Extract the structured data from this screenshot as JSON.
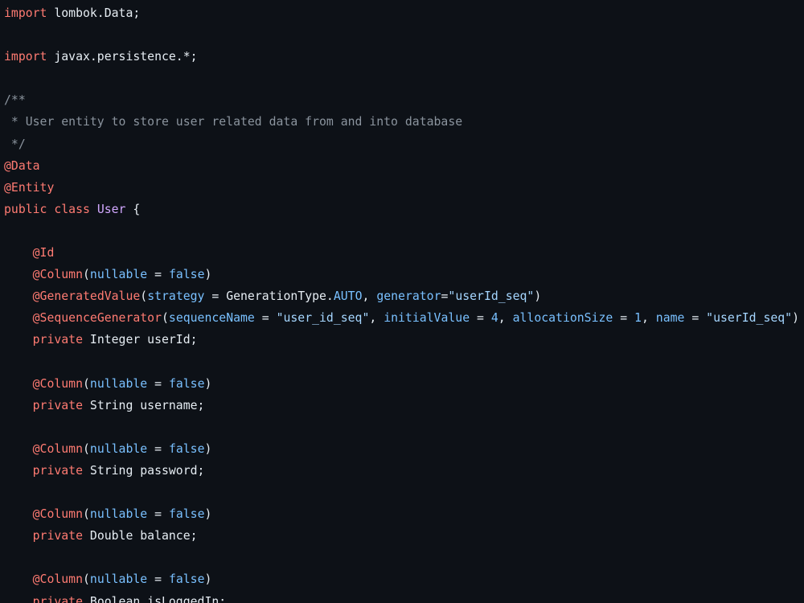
{
  "editor": {
    "theme": {
      "background": "#0d1117",
      "text": "#e6edf3",
      "keyword": "#ff7b72",
      "comment": "#8b949e",
      "attribute": "#79c0ff",
      "string": "#a5d6ff",
      "class_name": "#d2a8ff"
    },
    "lines": [
      [
        {
          "t": "keyword",
          "v": "import"
        },
        {
          "t": "plain",
          "v": " lombok.Data;"
        }
      ],
      [],
      [
        {
          "t": "keyword",
          "v": "import"
        },
        {
          "t": "plain",
          "v": " javax.persistence.*;"
        }
      ],
      [],
      [
        {
          "t": "comment",
          "v": "/**"
        }
      ],
      [
        {
          "t": "comment",
          "v": " * User entity to store user related data from and into database"
        }
      ],
      [
        {
          "t": "comment",
          "v": " */"
        }
      ],
      [
        {
          "t": "annotation",
          "v": "@Data"
        }
      ],
      [
        {
          "t": "annotation",
          "v": "@Entity"
        }
      ],
      [
        {
          "t": "keyword",
          "v": "public class"
        },
        {
          "t": "plain",
          "v": " "
        },
        {
          "t": "classname",
          "v": "User"
        },
        {
          "t": "plain",
          "v": " {"
        }
      ],
      [],
      [
        {
          "t": "plain",
          "v": "    "
        },
        {
          "t": "annotation",
          "v": "@Id"
        }
      ],
      [
        {
          "t": "plain",
          "v": "    "
        },
        {
          "t": "annotation",
          "v": "@Column"
        },
        {
          "t": "plain",
          "v": "("
        },
        {
          "t": "attr",
          "v": "nullable"
        },
        {
          "t": "plain",
          "v": " = "
        },
        {
          "t": "const",
          "v": "false"
        },
        {
          "t": "plain",
          "v": ")"
        }
      ],
      [
        {
          "t": "plain",
          "v": "    "
        },
        {
          "t": "annotation",
          "v": "@GeneratedValue"
        },
        {
          "t": "plain",
          "v": "("
        },
        {
          "t": "attr",
          "v": "strategy"
        },
        {
          "t": "plain",
          "v": " = GenerationType."
        },
        {
          "t": "const",
          "v": "AUTO"
        },
        {
          "t": "plain",
          "v": ", "
        },
        {
          "t": "attr",
          "v": "generator"
        },
        {
          "t": "plain",
          "v": "="
        },
        {
          "t": "string",
          "v": "\"userId_seq\""
        },
        {
          "t": "plain",
          "v": ")"
        }
      ],
      [
        {
          "t": "plain",
          "v": "    "
        },
        {
          "t": "annotation",
          "v": "@SequenceGenerator"
        },
        {
          "t": "plain",
          "v": "("
        },
        {
          "t": "attr",
          "v": "sequenceName"
        },
        {
          "t": "plain",
          "v": " = "
        },
        {
          "t": "string",
          "v": "\"user_id_seq\""
        },
        {
          "t": "plain",
          "v": ", "
        },
        {
          "t": "attr",
          "v": "initialValue"
        },
        {
          "t": "plain",
          "v": " = "
        },
        {
          "t": "const",
          "v": "4"
        },
        {
          "t": "plain",
          "v": ", "
        },
        {
          "t": "attr",
          "v": "allocationSize"
        },
        {
          "t": "plain",
          "v": " = "
        },
        {
          "t": "const",
          "v": "1"
        },
        {
          "t": "plain",
          "v": ", "
        },
        {
          "t": "attr",
          "v": "name"
        },
        {
          "t": "plain",
          "v": " = "
        },
        {
          "t": "string",
          "v": "\"userId_seq\""
        },
        {
          "t": "plain",
          "v": ")"
        }
      ],
      [
        {
          "t": "plain",
          "v": "    "
        },
        {
          "t": "keyword",
          "v": "private"
        },
        {
          "t": "plain",
          "v": " Integer userId;"
        }
      ],
      [],
      [
        {
          "t": "plain",
          "v": "    "
        },
        {
          "t": "annotation",
          "v": "@Column"
        },
        {
          "t": "plain",
          "v": "("
        },
        {
          "t": "attr",
          "v": "nullable"
        },
        {
          "t": "plain",
          "v": " = "
        },
        {
          "t": "const",
          "v": "false"
        },
        {
          "t": "plain",
          "v": ")"
        }
      ],
      [
        {
          "t": "plain",
          "v": "    "
        },
        {
          "t": "keyword",
          "v": "private"
        },
        {
          "t": "plain",
          "v": " String username;"
        }
      ],
      [],
      [
        {
          "t": "plain",
          "v": "    "
        },
        {
          "t": "annotation",
          "v": "@Column"
        },
        {
          "t": "plain",
          "v": "("
        },
        {
          "t": "attr",
          "v": "nullable"
        },
        {
          "t": "plain",
          "v": " = "
        },
        {
          "t": "const",
          "v": "false"
        },
        {
          "t": "plain",
          "v": ")"
        }
      ],
      [
        {
          "t": "plain",
          "v": "    "
        },
        {
          "t": "keyword",
          "v": "private"
        },
        {
          "t": "plain",
          "v": " String password;"
        }
      ],
      [],
      [
        {
          "t": "plain",
          "v": "    "
        },
        {
          "t": "annotation",
          "v": "@Column"
        },
        {
          "t": "plain",
          "v": "("
        },
        {
          "t": "attr",
          "v": "nullable"
        },
        {
          "t": "plain",
          "v": " = "
        },
        {
          "t": "const",
          "v": "false"
        },
        {
          "t": "plain",
          "v": ")"
        }
      ],
      [
        {
          "t": "plain",
          "v": "    "
        },
        {
          "t": "keyword",
          "v": "private"
        },
        {
          "t": "plain",
          "v": " Double balance;"
        }
      ],
      [],
      [
        {
          "t": "plain",
          "v": "    "
        },
        {
          "t": "annotation",
          "v": "@Column"
        },
        {
          "t": "plain",
          "v": "("
        },
        {
          "t": "attr",
          "v": "nullable"
        },
        {
          "t": "plain",
          "v": " = "
        },
        {
          "t": "const",
          "v": "false"
        },
        {
          "t": "plain",
          "v": ")"
        }
      ],
      [
        {
          "t": "plain",
          "v": "    "
        },
        {
          "t": "keyword",
          "v": "private"
        },
        {
          "t": "plain",
          "v": " Boolean isLoggedIn;"
        }
      ]
    ]
  }
}
